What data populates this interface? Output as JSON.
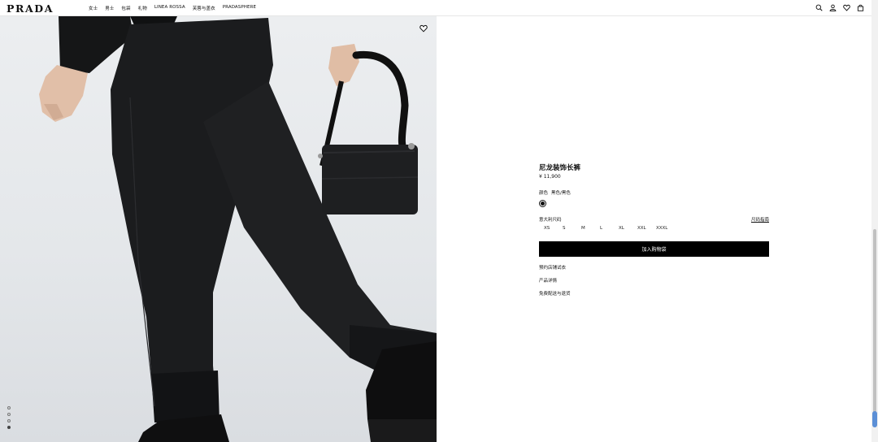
{
  "brand": "PRADA",
  "nav": [
    "女士",
    "男士",
    "包袋",
    "礼物",
    "LINEA ROSSA",
    "芙蓉与盖衣",
    "PRADASPHERE"
  ],
  "icons": [
    "search-icon",
    "account-icon",
    "wishlist-icon",
    "cart-icon"
  ],
  "gallery": {
    "slides": 4,
    "active_index": 3
  },
  "product": {
    "title": "尼龙装饰长裤",
    "price": "¥ 11,900",
    "color_label": "颜色",
    "color_value": "黑色/黑色",
    "size_label": "意大利尺码",
    "size_guide": "尺码指南",
    "sizes": [
      "XS",
      "S",
      "M",
      "L",
      "XL",
      "XXL",
      "XXXL"
    ],
    "add_to_cart": "加入购物袋",
    "links": [
      "预约店铺试衣",
      "产品详情",
      "免费配送与退货"
    ]
  },
  "colors": {
    "accent": "#000000",
    "background": "#ffffff",
    "photo_bg": "#e4e7ea",
    "scroll_indicator": "#5b8fd6"
  }
}
